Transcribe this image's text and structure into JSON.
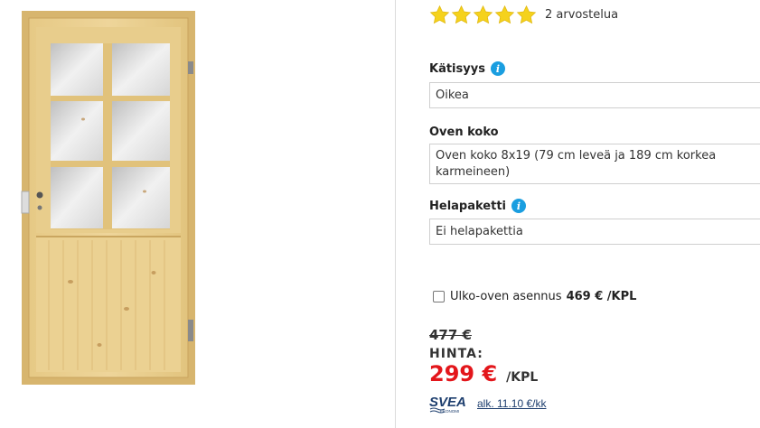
{
  "rating": {
    "value": 5,
    "max": 5,
    "review_count": "2 arvostelua",
    "star_color": "#f5d21c"
  },
  "options": {
    "handedness": {
      "label": "Kätisyys",
      "value": "Oikea"
    },
    "door_size": {
      "label": "Oven koko",
      "value": "Oven koko 8x19 (79 cm leveä ja 189 cm korkea karmeineen)"
    },
    "hardware": {
      "label": "Helapaketti",
      "value": "Ei helapakettia"
    }
  },
  "installation": {
    "label": "Ulko-oven asennus",
    "price": "469 € /KPL",
    "checked": false
  },
  "pricing": {
    "old_price": "477 €",
    "label": "HINTA:",
    "price": "299 €",
    "unit": "/KPL",
    "price_color": "#e3161b"
  },
  "financing": {
    "brand_text": "SVEA",
    "brand_subtext": "EKONOMI",
    "link_text": "alk. 11.10 €/kk",
    "brand_color": "#1d3e6e"
  }
}
